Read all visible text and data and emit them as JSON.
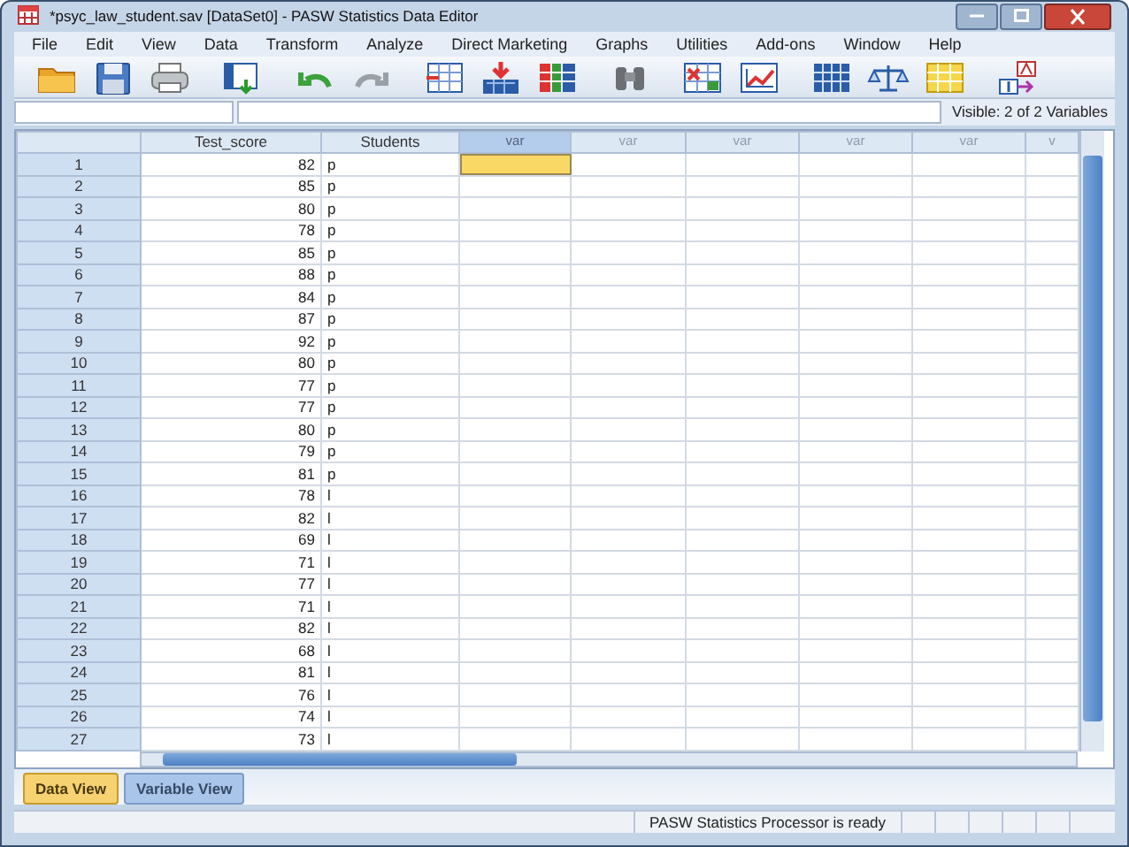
{
  "window": {
    "title": "*psyc_law_student.sav [DataSet0] - PASW Statistics Data Editor"
  },
  "menu": [
    "File",
    "Edit",
    "View",
    "Data",
    "Transform",
    "Analyze",
    "Direct Marketing",
    "Graphs",
    "Utilities",
    "Add-ons",
    "Window",
    "Help"
  ],
  "cell_editor": {
    "visible_info": "Visible: 2 of 2 Variables"
  },
  "grid": {
    "columns": [
      {
        "label": "Test_score",
        "kind": "number"
      },
      {
        "label": "Students",
        "kind": "string"
      },
      {
        "label": "var",
        "kind": "empty",
        "active": true
      },
      {
        "label": "var",
        "kind": "empty",
        "active": false
      },
      {
        "label": "var",
        "kind": "empty",
        "active": false
      },
      {
        "label": "var",
        "kind": "empty",
        "active": false
      },
      {
        "label": "var",
        "kind": "empty",
        "active": false
      },
      {
        "label": "v",
        "kind": "empty",
        "active": false
      }
    ],
    "rows": [
      {
        "number": "1",
        "test_score": "82",
        "students": "p",
        "active": true
      },
      {
        "number": "2",
        "test_score": "85",
        "students": "p",
        "active": false
      },
      {
        "number": "3",
        "test_score": "80",
        "students": "p",
        "active": false
      },
      {
        "number": "4",
        "test_score": "78",
        "students": "p",
        "active": false
      },
      {
        "number": "5",
        "test_score": "85",
        "students": "p",
        "active": false
      },
      {
        "number": "6",
        "test_score": "88",
        "students": "p",
        "active": false
      },
      {
        "number": "7",
        "test_score": "84",
        "students": "p",
        "active": false
      },
      {
        "number": "8",
        "test_score": "87",
        "students": "p",
        "active": false
      },
      {
        "number": "9",
        "test_score": "92",
        "students": "p",
        "active": false
      },
      {
        "number": "10",
        "test_score": "80",
        "students": "p",
        "active": false
      },
      {
        "number": "11",
        "test_score": "77",
        "students": "p",
        "active": false
      },
      {
        "number": "12",
        "test_score": "77",
        "students": "p",
        "active": false
      },
      {
        "number": "13",
        "test_score": "80",
        "students": "p",
        "active": false
      },
      {
        "number": "14",
        "test_score": "79",
        "students": "p",
        "active": false
      },
      {
        "number": "15",
        "test_score": "81",
        "students": "p",
        "active": false
      },
      {
        "number": "16",
        "test_score": "78",
        "students": "l",
        "active": false
      },
      {
        "number": "17",
        "test_score": "82",
        "students": "l",
        "active": false
      },
      {
        "number": "18",
        "test_score": "69",
        "students": "l",
        "active": false
      },
      {
        "number": "19",
        "test_score": "71",
        "students": "l",
        "active": false
      },
      {
        "number": "20",
        "test_score": "77",
        "students": "l",
        "active": false
      },
      {
        "number": "21",
        "test_score": "71",
        "students": "l",
        "active": false
      },
      {
        "number": "22",
        "test_score": "82",
        "students": "l",
        "active": false
      },
      {
        "number": "23",
        "test_score": "68",
        "students": "l",
        "active": false
      },
      {
        "number": "24",
        "test_score": "81",
        "students": "l",
        "active": false
      },
      {
        "number": "25",
        "test_score": "76",
        "students": "l",
        "active": false
      },
      {
        "number": "26",
        "test_score": "74",
        "students": "l",
        "active": false
      },
      {
        "number": "27",
        "test_score": "73",
        "students": "l",
        "active": false
      }
    ]
  },
  "tabs": [
    {
      "label": "Data View",
      "selected": true
    },
    {
      "label": "Variable View",
      "selected": false
    }
  ],
  "status_bar": {
    "message": "PASW Statistics Processor is ready"
  }
}
